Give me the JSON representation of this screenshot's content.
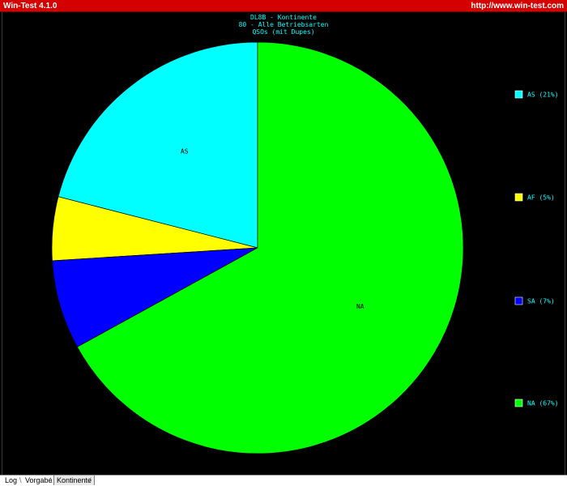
{
  "window": {
    "title": "Win-Test 4.1.0",
    "url": "http://www.win-test.com"
  },
  "tabs": [
    {
      "label": "Log",
      "active": false
    },
    {
      "label": "Vorgabe",
      "active": false
    },
    {
      "label": "Kontinente",
      "active": true
    }
  ],
  "colors": {
    "titlebar": "#d40000",
    "header_text": "#00ffff",
    "AS": "#00ffff",
    "AF": "#ffff00",
    "SA": "#0000ff",
    "NA": "#00ff00"
  },
  "chart_data": {
    "type": "pie",
    "title": [
      "DL8B - Kontinente",
      "80 - Alle Betriebsarten",
      "QSOs (mit Dupes)"
    ],
    "slices": [
      {
        "label": "AS",
        "value": 21,
        "legend": "AS (21%)",
        "color": "#00ffff"
      },
      {
        "label": "AF",
        "value": 5,
        "legend": "AF (5%)",
        "color": "#ffff00"
      },
      {
        "label": "SA",
        "value": 7,
        "legend": "SA (7%)",
        "color": "#0000ff"
      },
      {
        "label": "NA",
        "value": 67,
        "legend": "NA (67%)",
        "color": "#00ff00"
      }
    ],
    "legend_position": "right"
  }
}
